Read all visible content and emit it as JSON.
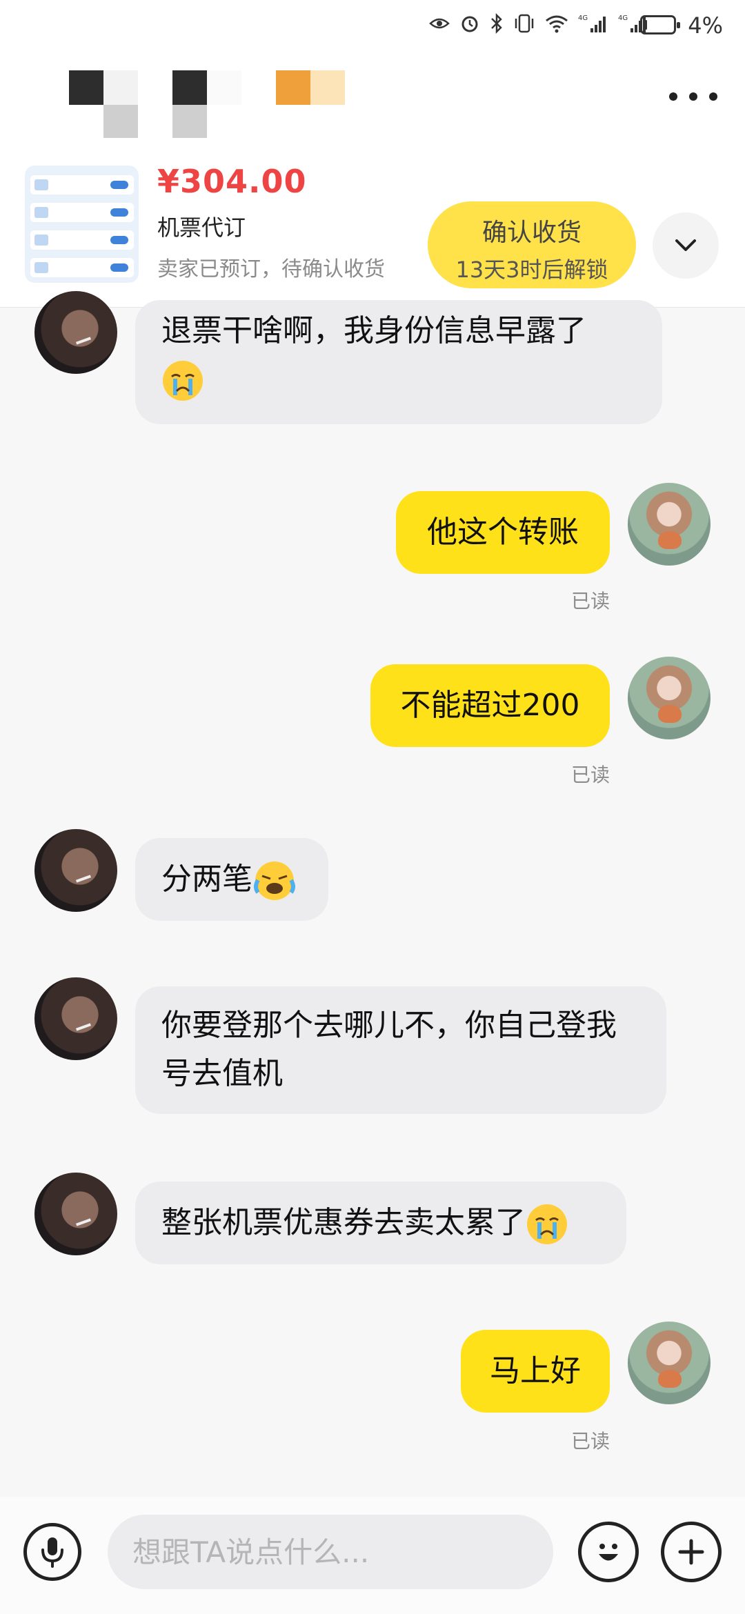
{
  "status_bar": {
    "battery_text": "4%",
    "battery_level": 0.04,
    "icons": [
      "eye-icon",
      "alarm-icon",
      "bluetooth-icon",
      "vibrate-icon",
      "wifi-icon",
      "signal-4g-icon",
      "signal-4g-icon"
    ]
  },
  "header": {
    "contact_name_blurred": true,
    "more_icon": "more-dots-icon"
  },
  "order": {
    "price": "¥304.00",
    "title": "机票代订",
    "status": "卖家已预订，待确认收货",
    "confirm_label": "确认收货",
    "confirm_sub": "13天3时后解锁",
    "expand_icon": "chevron-down-icon"
  },
  "messages": [
    {
      "side": "in",
      "text": "退票干啥啊，我身份信息早露了",
      "emoji": "crying-face"
    },
    {
      "side": "out",
      "text": "他这个转账",
      "read": "已读"
    },
    {
      "side": "out",
      "text": "不能超过200",
      "read": "已读"
    },
    {
      "side": "in",
      "text": "分两笔",
      "emoji": "loudly-crying-face"
    },
    {
      "side": "in",
      "text": "你要登那个去哪儿不，你自己登我号去值机"
    },
    {
      "side": "in",
      "text": "整张机票优惠券去卖太累了",
      "emoji": "crying-face"
    },
    {
      "side": "out",
      "text": "马上好",
      "read": "已读"
    }
  ],
  "input": {
    "placeholder": "想跟TA说点什么..."
  },
  "colors": {
    "accent": "#FFE11A",
    "confirm_bg": "#FFE14A",
    "price": "#EE4444",
    "incoming_bubble": "#ECECEE"
  }
}
